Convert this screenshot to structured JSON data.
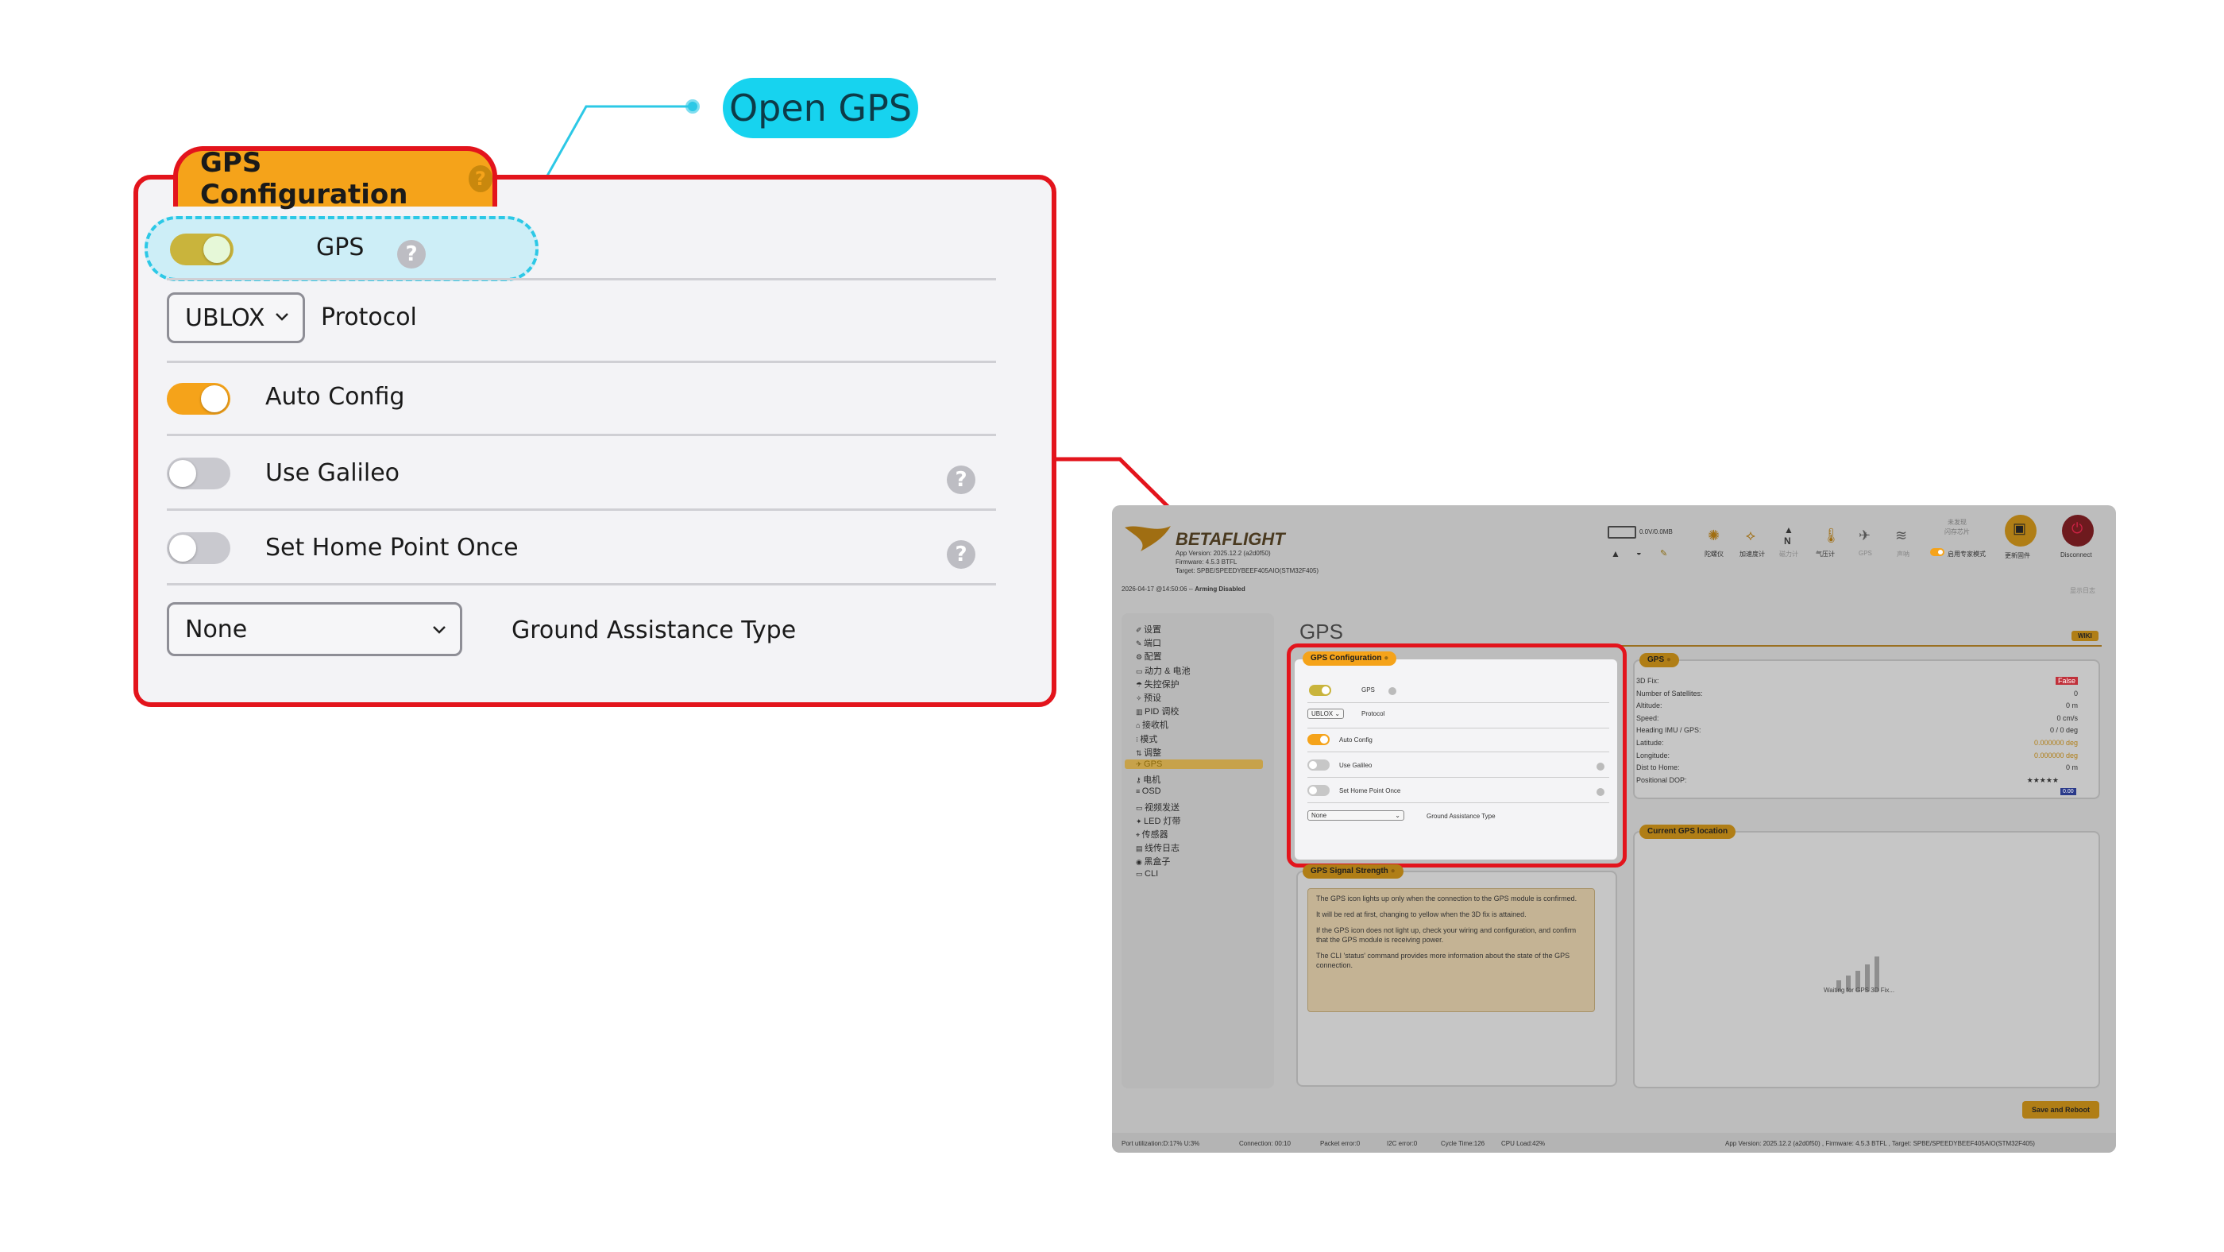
{
  "callout": {
    "open_gps_label": "Open GPS",
    "header_title": "GPS Configuration",
    "header_help": "?",
    "gps_label": "GPS",
    "gps_help": "?",
    "protocol_value": "UBLOX",
    "protocol_label": "Protocol",
    "auto_config_label": "Auto Config",
    "use_galileo_label": "Use Galileo",
    "use_galileo_help": "?",
    "set_home_label": "Set Home Point Once",
    "set_home_help": "?",
    "ground_assist_value": "None",
    "ground_assist_label": "Ground Assistance Type",
    "toggles": {
      "gps": true,
      "auto_config": true,
      "use_galileo": false,
      "set_home_point_once": false
    }
  },
  "app": {
    "logo_text": "BETAFLIGHT",
    "app_version": "App Version: 2025.12.2 (a2d0f50)",
    "firmware": "Firmware: 4.5.3 BTFL",
    "target": "Target: SPBE/SPEEDYBEEF405AIO(STM32F405)",
    "datetime": "2026-04-17 @14:50:06 --",
    "arming": "Arming Disabled",
    "battery_text": "0.0V/0.0MB",
    "sensors": [
      "陀螺仪",
      "加速度计",
      "磁力计",
      "气压计",
      "GPS",
      "声呐"
    ],
    "expert_line1": "未发现",
    "expert_line2": "闪存芯片",
    "expert_mode": "启用专家模式",
    "update_firmware": "更新固件",
    "disconnect": "Disconnect",
    "show_log": "显示日志",
    "nav": [
      "设置",
      "端口",
      "配置",
      "动力 & 电池",
      "失控保护",
      "预设",
      "PID 调校",
      "接收机",
      "模式",
      "调整",
      "GPS",
      "电机",
      "OSD",
      "视频发送",
      "LED 灯带",
      "传感器",
      "线传日志",
      "黑盒子",
      "CLI"
    ],
    "page_title": "GPS",
    "wiki": "WIKI",
    "config_title": "GPS Configuration",
    "config_gps": "GPS",
    "config_protocol_value": "UBLOX",
    "config_protocol": "Protocol",
    "config_auto_config": "Auto Config",
    "config_galileo": "Use Galileo",
    "config_home": "Set Home Point Once",
    "config_ground_value": "None",
    "config_ground": "Ground Assistance Type",
    "signal_title": "GPS Signal Strength",
    "signal_p1": "The GPS icon lights up only when the connection to the GPS module is confirmed.",
    "signal_p2": "It will be red at first, changing to yellow when the 3D fix is attained.",
    "signal_p3": "If the GPS icon does not light up, check your wiring and configuration, and confirm that the GPS module is receiving power.",
    "signal_p4": "The CLI 'status' command provides more information about the state of the GPS connection.",
    "gps_title": "GPS",
    "gps_rows": [
      {
        "k": "3D Fix:",
        "v": "False"
      },
      {
        "k": "Number of Satellites:",
        "v": "0"
      },
      {
        "k": "Altitude:",
        "v": "0 m"
      },
      {
        "k": "Speed:",
        "v": "0 cm/s"
      },
      {
        "k": "Heading IMU / GPS:",
        "v": "0 / 0 deg"
      },
      {
        "k": "Latitude:",
        "v": "0.000000 deg"
      },
      {
        "k": "Longitude:",
        "v": "0.000000 deg"
      },
      {
        "k": "Dist to Home:",
        "v": "0 m"
      },
      {
        "k": "Positional DOP:",
        "v": "★★★★★"
      }
    ],
    "dop_badge": "0.00",
    "location_title": "Current GPS location",
    "waiting": "Waiting for GPS 3D Fix...",
    "save_reboot": "Save and Reboot",
    "status_port": "Port utilization:D:17% U:3%",
    "status_connection": "Connection: 00:10",
    "status_packet": "Packet error:0",
    "status_i2c": "I2C error:0",
    "status_cycle": "Cycle Time:126",
    "status_cpu": "CPU Load:42%",
    "status_right": "App Version: 2025.12.2 (a2d0f50) , Firmware: 4.5.3 BTFL , Target: SPBE/SPEEDYBEEF405AIO(STM32F405)"
  },
  "colors": {
    "highlight_red": "#e3141c",
    "accent_orange": "#f5a31a",
    "cyan_badge": "#17d3ef"
  }
}
